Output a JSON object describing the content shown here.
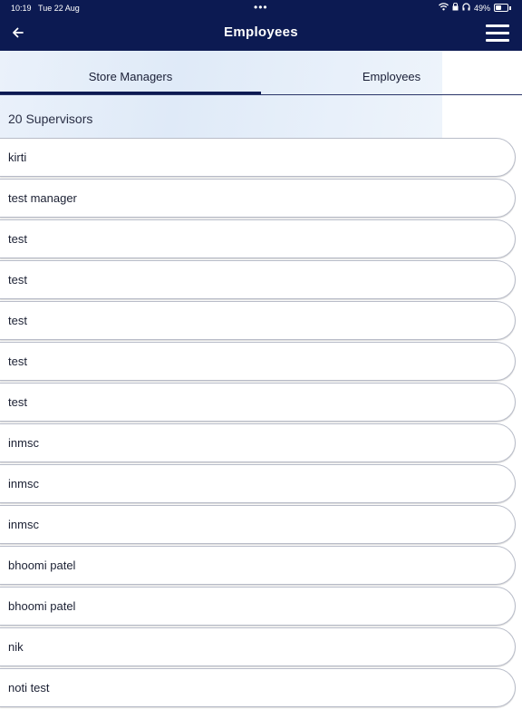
{
  "status_bar": {
    "time": "10:19",
    "date": "Tue 22 Aug",
    "battery": "49%",
    "battery_level": 0.49
  },
  "app_bar": {
    "title": "Employees"
  },
  "tabs": [
    {
      "label": "Store Managers",
      "active": true
    },
    {
      "label": "Employees",
      "active": false
    }
  ],
  "supervisor_count": "20 Supervisors",
  "employees": [
    "kirti",
    "test manager",
    "test",
    "test",
    "test",
    "test",
    "test",
    "inmsc",
    "inmsc",
    "inmsc",
    "bhoomi patel",
    "bhoomi patel",
    "nik",
    "noti test"
  ],
  "colors": {
    "header": "#0c1a52",
    "tab_active_indicator": "#0c1a52"
  }
}
